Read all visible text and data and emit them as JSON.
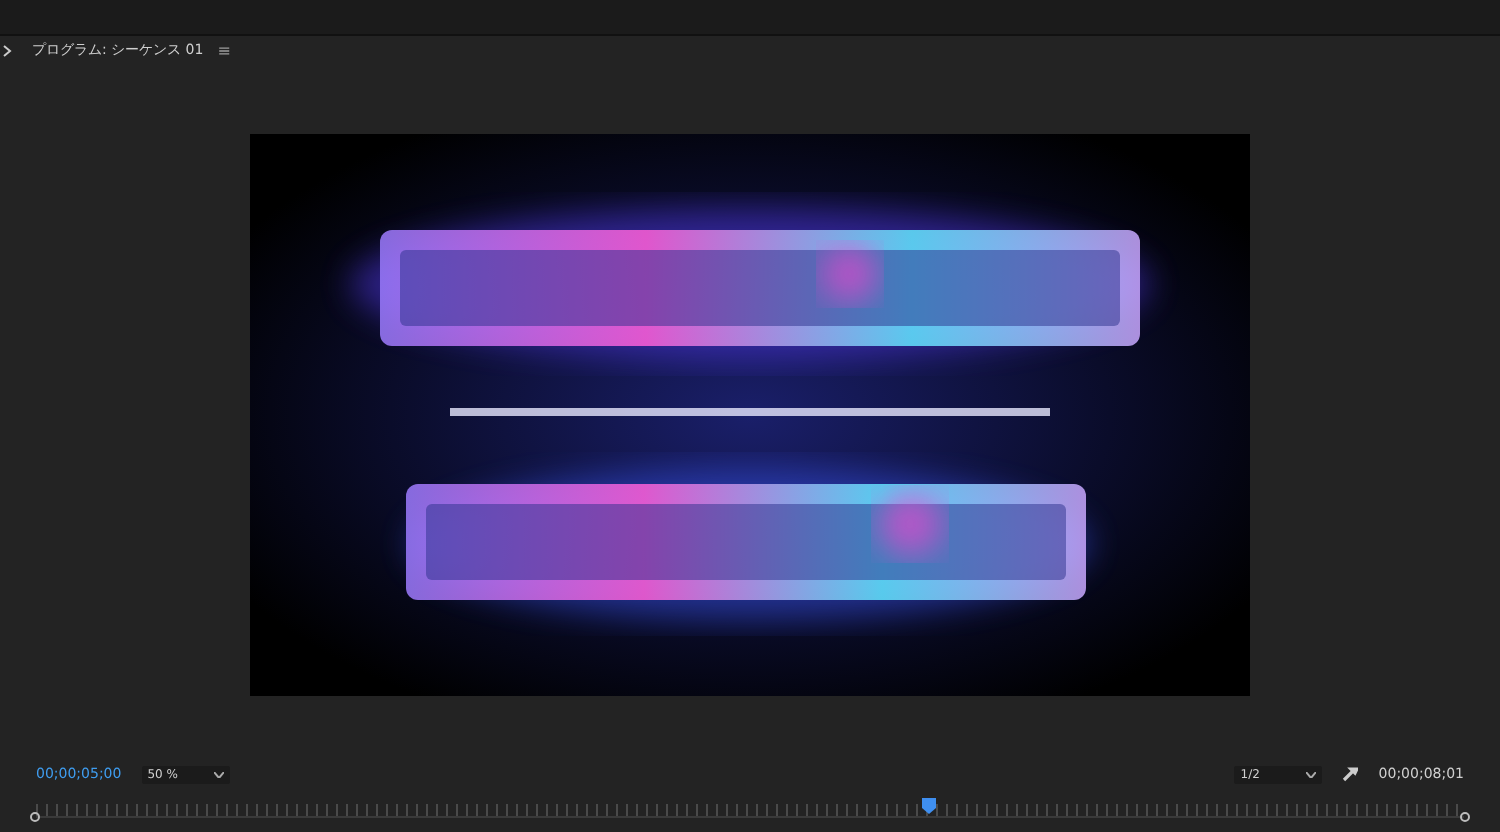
{
  "panel": {
    "title": "プログラム: シーケンス 01",
    "menu_icon": "≡"
  },
  "controls": {
    "current_time": "00;00;05;00",
    "zoom": "50 %",
    "resolution": "1/2",
    "duration": "00;00;08;01"
  },
  "timeline": {
    "playhead": {
      "level": 0.625
    }
  }
}
